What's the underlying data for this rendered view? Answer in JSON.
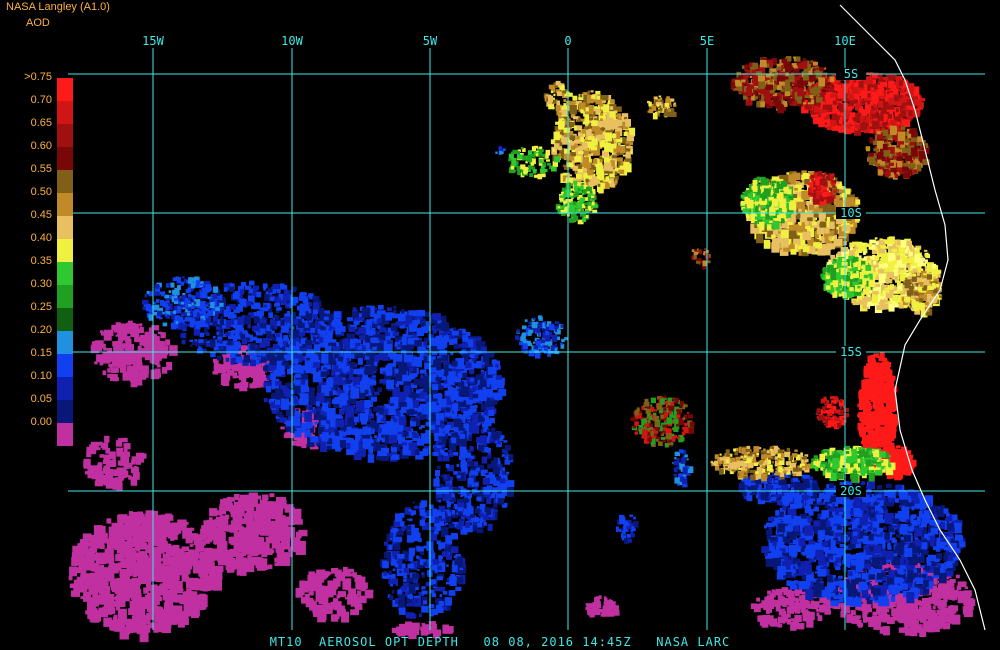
{
  "header": {
    "title": "NASA Langley (A1.0)",
    "subtitle": "AOD"
  },
  "legend": [
    {
      "label": ">0.75",
      "color": "#ff1a1a"
    },
    {
      "label": "0.70",
      "color": "#d01515"
    },
    {
      "label": "0.65",
      "color": "#a01010"
    },
    {
      "label": "0.60",
      "color": "#780808"
    },
    {
      "label": "0.55",
      "color": "#806018"
    },
    {
      "label": "0.50",
      "color": "#c08a28"
    },
    {
      "label": "0.45",
      "color": "#e8c060"
    },
    {
      "label": "0.40",
      "color": "#f0f040"
    },
    {
      "label": "0.35",
      "color": "#30c830"
    },
    {
      "label": "0.30",
      "color": "#20a020"
    },
    {
      "label": "0.25",
      "color": "#106010"
    },
    {
      "label": "0.20",
      "color": "#2090e0"
    },
    {
      "label": "0.15",
      "color": "#1040f0"
    },
    {
      "label": "0.10",
      "color": "#1020b0"
    },
    {
      "label": "0.05",
      "color": "#081878"
    },
    {
      "label": "0.00",
      "color": "#c030a0"
    }
  ],
  "longitudes": [
    "15W",
    "10W",
    "5W",
    "0",
    "5E",
    "10E"
  ],
  "latitudes": [
    "5S",
    "10S",
    "15S",
    "20S"
  ],
  "footer": "MT10  AEROSOL OPT DEPTH   08 08, 2016 14:45Z   NASA LARC",
  "colors": {
    "grid": "#40e8e8",
    "text": "#ffb040",
    "coast": "#ffffff"
  }
}
